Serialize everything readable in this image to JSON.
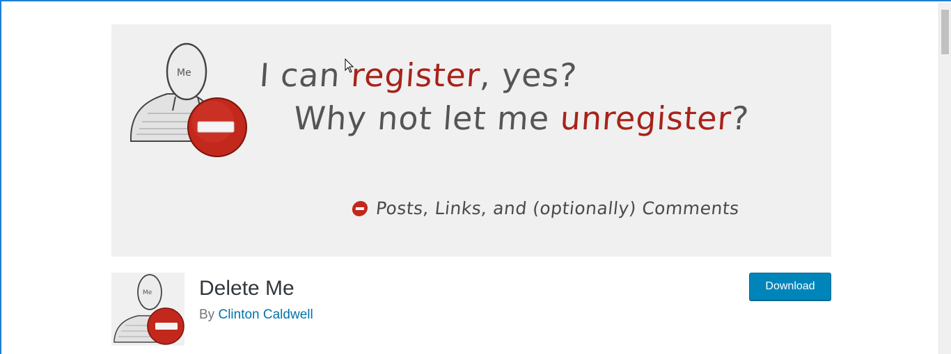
{
  "banner": {
    "line1_part1": "I can ",
    "line1_highlight": "register",
    "line1_part2": ", yes?",
    "line2_part1": "Why not let me ",
    "line2_highlight": "unregister",
    "line2_part2": "?",
    "line3": "Posts, Links, and (optionally) Comments",
    "avatar_label": "Me"
  },
  "plugin": {
    "thumbnail_label": "Me",
    "title": "Delete Me",
    "by_label": "By",
    "author": "Clinton Caldwell",
    "download_label": "Download"
  },
  "colors": {
    "accent_red": "#a7231a",
    "button_blue": "#0085ba",
    "link_blue": "#0073aa",
    "window_border": "#1e7fd6"
  },
  "icons": {
    "avatar": "person-sketch-icon",
    "stop": "stop-sign-icon",
    "cursor": "mouse-pointer-icon"
  }
}
